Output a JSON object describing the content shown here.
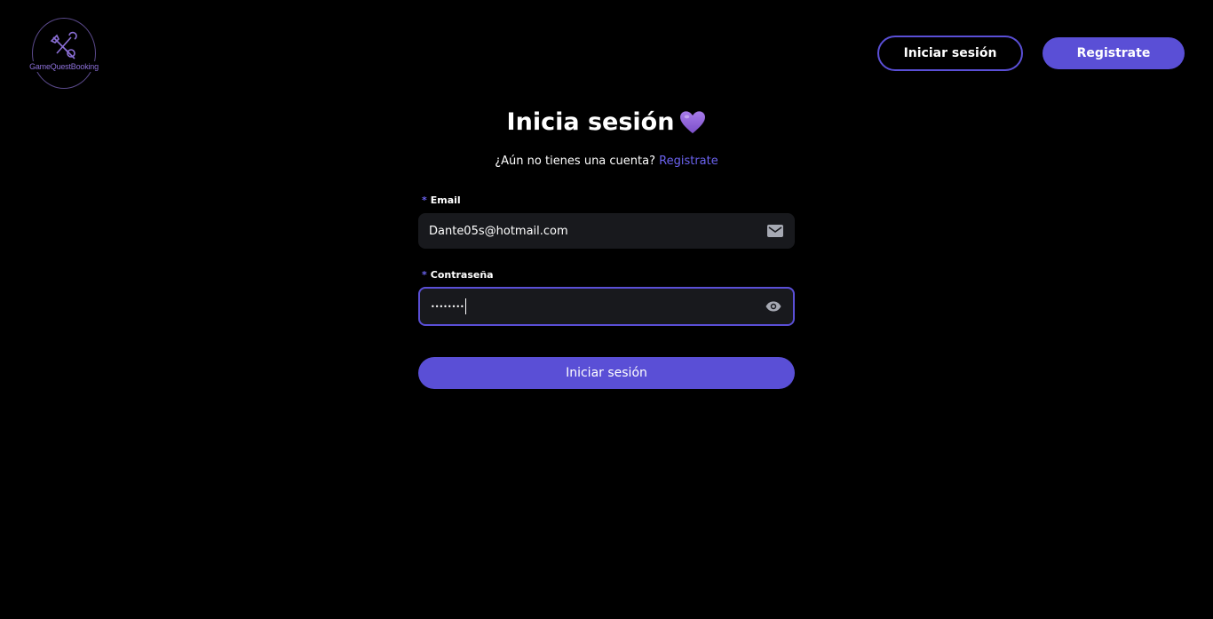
{
  "header": {
    "logo_text": "GameQuestBooking",
    "login_label": "Iniciar sesión",
    "register_label": "Registrate"
  },
  "main": {
    "title": "Inicia sesión",
    "subtitle_text": "¿Aún no tienes una cuenta?",
    "subtitle_link": "Registrate",
    "email": {
      "label": "Email",
      "required_mark": "*",
      "value": "Dante05s@hotmail.com",
      "icon": "mail-icon"
    },
    "password": {
      "label": "Contraseña",
      "required_mark": "*",
      "masked_value": "••••••••",
      "icon": "eye-icon",
      "focused": true
    },
    "submit_label": "Iniciar sesión"
  },
  "colors": {
    "background": "#000000",
    "accent": "#5a4fd6",
    "link": "#6b63f0",
    "input_bg": "#18191d",
    "logo": "#8b6fd6"
  }
}
